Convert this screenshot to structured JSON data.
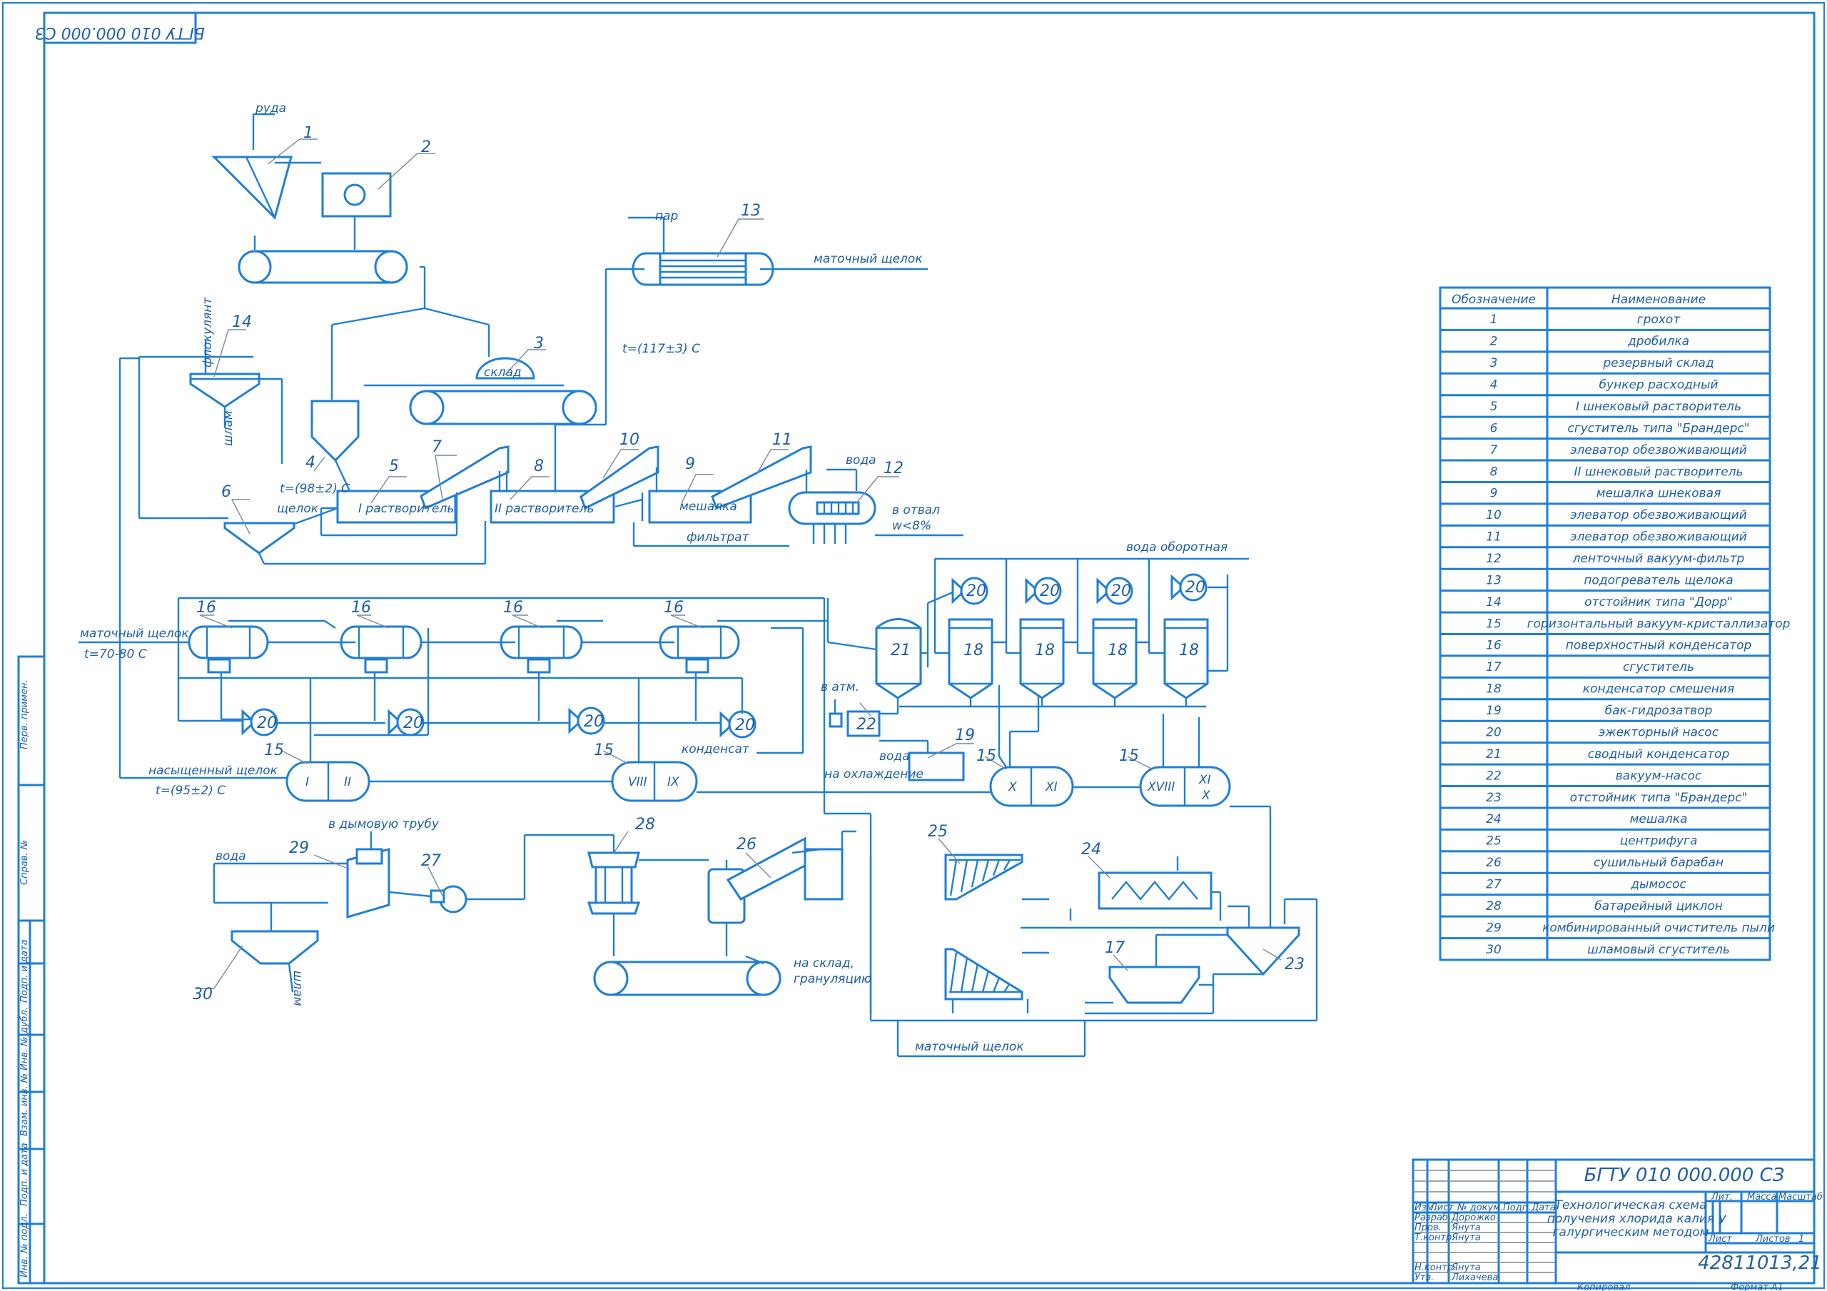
{
  "doc_code": "БГТУ 010 000.000 СЗ",
  "title_block": {
    "title_lines": [
      "Технологическая схема",
      "получения хлорида калия",
      "галургическим методом"
    ],
    "roles": [
      "Разраб.",
      "Пров.",
      "Т.контр.",
      "Н.контр.",
      "Утв."
    ],
    "names": [
      "Дорожко",
      "Янута",
      "Янута",
      "Янута",
      "Лихачева"
    ],
    "hdr": [
      "Изм.",
      "Лист",
      "№ докум.",
      "Подп.",
      "Дата"
    ],
    "lit_hdr": [
      "Лит.",
      "Масса",
      "Масштаб"
    ],
    "lit_val": "У",
    "sheet_lbl": "Лист",
    "sheets_lbl": "Листов",
    "sheets_val": "1",
    "group": "42811013,21",
    "copied": "Копировал",
    "format": "Формат   А1"
  },
  "left_strip": [
    "Перв. примен.",
    "Справ. №",
    "Подп. и дата",
    "Инв. № дубл.",
    "Взам. инв. №",
    "Подп. и дата",
    "Инв. № подл."
  ],
  "spec": {
    "headers": [
      "Обозначение",
      "Наименование"
    ],
    "rows": [
      [
        "1",
        "грохот"
      ],
      [
        "2",
        "дробилка"
      ],
      [
        "3",
        "резервный склад"
      ],
      [
        "4",
        "бункер расходный"
      ],
      [
        "5",
        "I шнековый растворитель"
      ],
      [
        "6",
        "сгуститель типа \"Брандерс\""
      ],
      [
        "7",
        "элеватор обезвоживающий"
      ],
      [
        "8",
        "II шнековый растворитель"
      ],
      [
        "9",
        "мешалка шнековая"
      ],
      [
        "10",
        "элеватор обезвоживающий"
      ],
      [
        "11",
        "элеватор обезвоживающий"
      ],
      [
        "12",
        "ленточный вакуум-фильтр"
      ],
      [
        "13",
        "подогреватель щелока"
      ],
      [
        "14",
        "отстойник типа \"Дорр\""
      ],
      [
        "15",
        "горизонтальный вакуум-кристаллизатор"
      ],
      [
        "16",
        "поверхностный конденсатор"
      ],
      [
        "17",
        "сгуститель"
      ],
      [
        "18",
        "конденсатор смешения"
      ],
      [
        "19",
        "бак-гидрозатвор"
      ],
      [
        "20",
        "эжекторный насос"
      ],
      [
        "21",
        "сводный конденсатор"
      ],
      [
        "22",
        "вакуум-насос"
      ],
      [
        "23",
        "отстойник типа \"Брандерс\""
      ],
      [
        "24",
        "мешалка"
      ],
      [
        "25",
        "центрифуга"
      ],
      [
        "26",
        "сушильный барабан"
      ],
      [
        "27",
        "дымосос"
      ],
      [
        "28",
        "батарейный циклон"
      ],
      [
        "29",
        "комбинированный очиститель пыли"
      ],
      [
        "30",
        "шламовый сгуститель"
      ]
    ]
  },
  "labels": {
    "ruda": "руда",
    "flokulyant": "флокулянт",
    "shlam": "шлам",
    "sklad": "склад",
    "par": "пар",
    "matochny_shchelok": "маточный щелок",
    "t1": "t=(117±3) C",
    "t2": "t=(98±2) C",
    "shchelok": "щелок",
    "r1": "I растворитель",
    "r2": "II растворитель",
    "meshalka": "мешалка",
    "voda": "вода",
    "v_otval": "в отвал",
    "w": "w<8%",
    "filtrat": "фильтрат",
    "voda_oborotnaya": "вода оборотная",
    "t3": "t=70-80 C",
    "v_atm": "в атм.",
    "kondensat": "конденсат",
    "voda_ohl1": "вода",
    "voda_ohl2": "на охлаждение",
    "nas_shchelok": "насыщенный щелок",
    "t4": "t=(95±2) C",
    "v_dym": "в дымовую трубу",
    "na_sklad1": "на склад,",
    "na_sklad2": "грануляцию",
    "cr1": "I",
    "cr2": "II",
    "cr3": "VIII",
    "cr4": "IX",
    "cr5": "X",
    "cr6": "XI",
    "cr7": "XVIII",
    "cr8": "XI",
    "cr9": "X"
  },
  "pos": [
    "1",
    "2",
    "3",
    "4",
    "5",
    "6",
    "7",
    "8",
    "9",
    "10",
    "11",
    "12",
    "13",
    "14",
    "15",
    "16",
    "17",
    "18",
    "19",
    "20",
    "21",
    "22",
    "23",
    "24",
    "25",
    "26",
    "27",
    "28",
    "29",
    "30"
  ]
}
